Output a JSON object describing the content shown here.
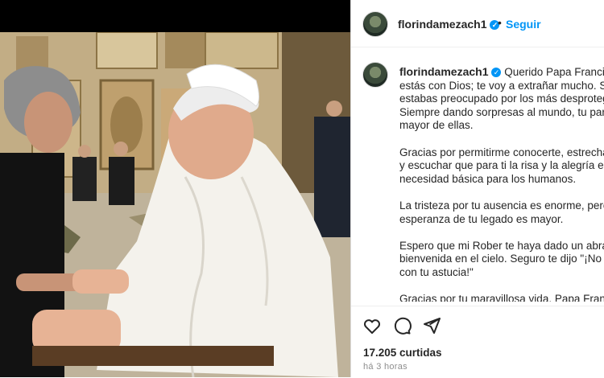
{
  "post": {
    "username": "florindamezach1",
    "follow_label": "Seguir",
    "separator": "•",
    "verified_mark": "✓",
    "caption_paragraphs": [
      [
        "Querido Papa Francisco",
        "estás con Dios; te voy a extrañar mucho. Sie",
        "estabas preocupado por los más desproteg",
        "Siempre dando sorpresas al mundo, tu part",
        "mayor de ellas."
      ],
      [
        "Gracias por permitirme conocerte, estrecha",
        "y escuchar que para ti la risa y la alegría era",
        "necesidad básica para los humanos."
      ],
      [
        "La tristeza por tu ausencia es enorme, pero",
        "esperanza de tu legado es mayor."
      ],
      [
        "Espero que mi Rober te haya dado un abraz",
        "bienvenida en el cielo. Seguro te dijo \"¡No c",
        "con tu astucia!\""
      ],
      [
        "Gracias por tu maravillosa vida, Papa Franci"
      ]
    ],
    "likes": "17.205 curtidas",
    "time_ago": "há 3 horas"
  },
  "icons": {
    "like": "heart-icon",
    "comment": "comment-icon",
    "share": "share-icon"
  },
  "colors": {
    "accent": "#0095f6",
    "text": "#262626",
    "muted": "#8e8e8e"
  }
}
